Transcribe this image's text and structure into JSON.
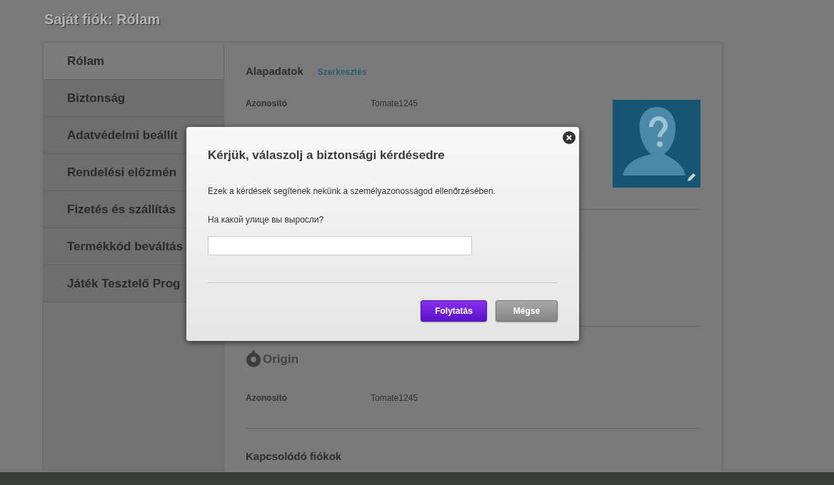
{
  "page_title": "Saját fiók: Rólam",
  "sidebar": {
    "items": [
      {
        "label": "Rólam",
        "selected": true
      },
      {
        "label": "Biztonság",
        "selected": false
      },
      {
        "label": "Adatvédelmi beállít",
        "selected": false
      },
      {
        "label": "Rendelési előzmén",
        "selected": false
      },
      {
        "label": "Fizetés és szállítás",
        "selected": false
      },
      {
        "label": "Termékkód beváltás",
        "selected": false
      },
      {
        "label": "Játék Tesztelő Prog",
        "selected": false
      }
    ]
  },
  "basic": {
    "heading": "Alapadatok",
    "edit_link": "Szerkesztés",
    "rows": [
      {
        "label": "Azonosító",
        "value": "Tomate1245"
      }
    ]
  },
  "origin": {
    "logo_text": "Origin",
    "rows": [
      {
        "label": "Azonosító",
        "value": "Tomate1245"
      }
    ]
  },
  "linked": {
    "heading": "Kapcsolódó fiókok"
  },
  "dialog": {
    "title": "Kérjük, válaszolj a biztonsági kérdésedre",
    "description": "Ezek a kérdések segítenek nekünk a személyazonosságod ellenőrzésében.",
    "question": "На какой улице вы выросли?",
    "buttons": [
      {
        "label": "Folytatás",
        "kind": "primary"
      },
      {
        "label": "Mégse",
        "kind": "secondary"
      }
    ]
  }
}
